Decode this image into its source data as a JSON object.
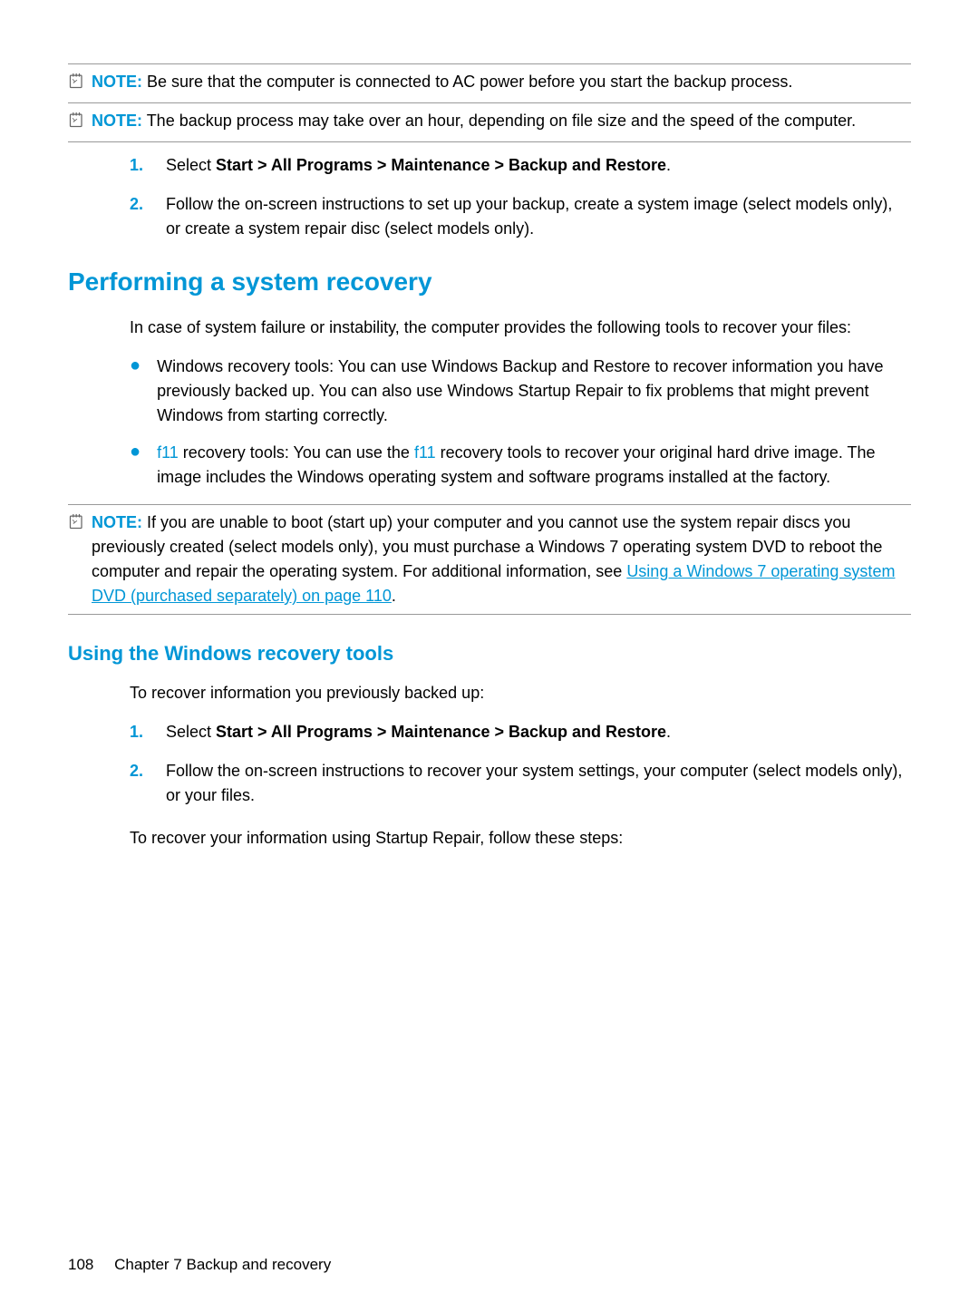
{
  "notes": {
    "note1": {
      "label": "NOTE:",
      "text": "Be sure that the computer is connected to AC power before you start the backup process."
    },
    "note2": {
      "label": "NOTE:",
      "text": "The backup process may take over an hour, depending on file size and the speed of the computer."
    },
    "note3": {
      "label": "NOTE:",
      "text_before": "If you are unable to boot (start up) your computer and you cannot use the system repair discs you previously created (select models only), you must purchase a Windows 7 operating system DVD to reboot the computer and repair the operating system. For additional information, see ",
      "link": "Using a Windows 7 operating system DVD (purchased separately) on page 110",
      "text_after": "."
    }
  },
  "list1": {
    "item1": {
      "num": "1.",
      "prefix": "Select ",
      "bold": "Start > All Programs > Maintenance > Backup and Restore",
      "suffix": "."
    },
    "item2": {
      "num": "2.",
      "text": "Follow the on-screen instructions to set up your backup, create a system image (select models only), or create a system repair disc (select models only)."
    }
  },
  "section1": {
    "heading": "Performing a system recovery",
    "para1": "In case of system failure or instability, the computer provides the following tools to recover your files:",
    "bullets": {
      "b1": "Windows recovery tools: You can use Windows Backup and Restore to recover information you have previously backed up. You can also use Windows Startup Repair to fix problems that might prevent Windows from starting correctly.",
      "b2_key1": "f11",
      "b2_mid1": " recovery tools: You can use the ",
      "b2_key2": "f11",
      "b2_mid2": " recovery tools to recover your original hard drive image. The image includes the Windows operating system and software programs installed at the factory."
    }
  },
  "section2": {
    "heading": "Using the Windows recovery tools",
    "para1": "To recover information you previously backed up:",
    "list": {
      "item1": {
        "num": "1.",
        "prefix": "Select ",
        "bold": "Start > All Programs > Maintenance > Backup and Restore",
        "suffix": "."
      },
      "item2": {
        "num": "2.",
        "text": "Follow the on-screen instructions to recover your system settings, your computer (select models only), or your files."
      }
    },
    "para2": "To recover your information using Startup Repair, follow these steps:"
  },
  "footer": {
    "page": "108",
    "chapter": "Chapter 7   Backup and recovery"
  }
}
